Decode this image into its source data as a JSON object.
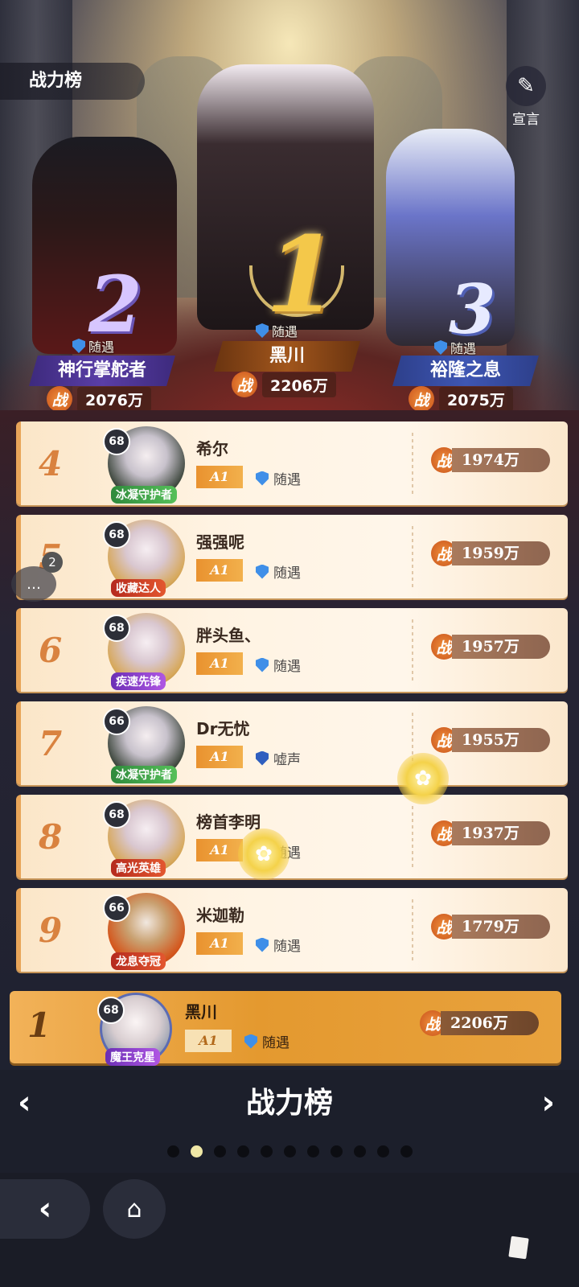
{
  "header": {
    "title": "战力榜",
    "declare_label": "宣言",
    "declare_icon": "edit-note-icon"
  },
  "podium": [
    {
      "rank": "1",
      "guild": "随遇",
      "name": "黑川",
      "power_label": "战",
      "power": "2206万"
    },
    {
      "rank": "2",
      "guild": "随遇",
      "name": "神行掌舵者",
      "power_label": "战",
      "power": "2076万"
    },
    {
      "rank": "3",
      "guild": "随遇",
      "name": "裕隆之息",
      "power_label": "战",
      "power": "2075万"
    }
  ],
  "rows": [
    {
      "rank": "4",
      "level": "68",
      "badge": "冰凝守护者",
      "name": "希尔",
      "tier": "A1",
      "guild": "随遇",
      "power_label": "战",
      "power": "1974万"
    },
    {
      "rank": "5",
      "level": "68",
      "badge": "收藏达人",
      "name": "强强呢",
      "tier": "A1",
      "guild": "随遇",
      "power_label": "战",
      "power": "1959万"
    },
    {
      "rank": "6",
      "level": "68",
      "badge": "疾速先锋",
      "name": "胖头鱼、",
      "tier": "A1",
      "guild": "随遇",
      "power_label": "战",
      "power": "1957万"
    },
    {
      "rank": "7",
      "level": "66",
      "badge": "冰凝守护者",
      "name": "Dr无忧",
      "tier": "A1",
      "guild": "嘘声",
      "power_label": "战",
      "power": "1955万"
    },
    {
      "rank": "8",
      "level": "68",
      "badge": "高光英雄",
      "name": "榜首李明",
      "tier": "A1",
      "guild": "随遇",
      "power_label": "战",
      "power": "1937万"
    },
    {
      "rank": "9",
      "level": "66",
      "badge": "龙息夺冠",
      "name": "米迦勒",
      "tier": "A1",
      "guild": "随遇",
      "power_label": "战",
      "power": "1779万"
    }
  ],
  "my_row": {
    "rank": "1",
    "level": "68",
    "badge": "魔王克星",
    "name": "黑川",
    "tier": "A1",
    "guild": "随遇",
    "power_label": "战",
    "power": "2206万"
  },
  "chat": {
    "count": "2",
    "icon": "chat-bubble-icon"
  },
  "footer": {
    "title": "战力榜",
    "page_count": 11,
    "active_page": 2
  },
  "colors": {
    "accent": "#e8a559",
    "my_row": "#e4992f",
    "power_badge": "#d9602a"
  }
}
